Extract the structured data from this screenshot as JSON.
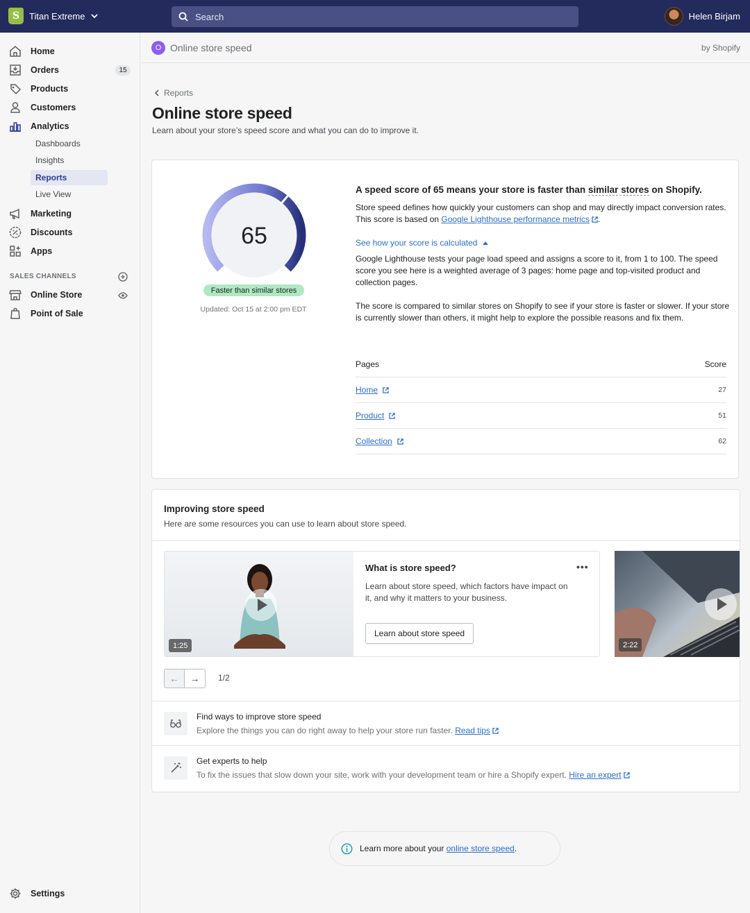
{
  "topbar": {
    "store_name": "Titan Extreme",
    "search_placeholder": "Search",
    "user_name": "Helen Birjam",
    "logo_letter": "S"
  },
  "sidebar": {
    "items": [
      {
        "label": "Home"
      },
      {
        "label": "Orders",
        "badge": "15"
      },
      {
        "label": "Products"
      },
      {
        "label": "Customers"
      },
      {
        "label": "Analytics"
      }
    ],
    "analytics_sub": [
      {
        "label": "Dashboards"
      },
      {
        "label": "Insights"
      },
      {
        "label": "Reports",
        "active": true
      },
      {
        "label": "Live View"
      }
    ],
    "items2": [
      {
        "label": "Marketing"
      },
      {
        "label": "Discounts"
      },
      {
        "label": "Apps"
      }
    ],
    "sales_channels_label": "SALES CHANNELS",
    "channels": [
      {
        "label": "Online Store"
      },
      {
        "label": "Point of Sale"
      }
    ],
    "settings_label": "Settings"
  },
  "app_header": {
    "icon_letter": "O",
    "name": "Online store speed",
    "by": "by Shopify"
  },
  "page": {
    "breadcrumb": "Reports",
    "title": "Online store speed",
    "subtitle": "Learn about your store’s speed score and what you can do to improve it."
  },
  "score_card": {
    "score": "65",
    "score_value": 65,
    "score_max": 100,
    "status": "Faster than similar stores",
    "updated": "Updated: Oct 15 at 2:00 pm EDT",
    "headline_pre": "A speed score of 65 means your store is faster than ",
    "headline_link": "similar stores",
    "headline_post": " on Shopify.",
    "desc_pre": "Store speed defines how quickly your customers can shop and may directly impact conversion rates. This score is based on ",
    "desc_link": "Google Lighthouse performance metrics",
    "desc_post": ".",
    "toggle_label": "See how your score is calculated",
    "explain1": "Google Lighthouse tests your page load speed and assigns a score to it, from 1 to 100. The speed score you see here is a weighted average of 3 pages: home page and top-visited product and collection pages.",
    "explain2": "The score is compared to similar stores on Shopify to see if your store is faster or slower. If your store is currently slower than others, it might help to explore the possible reasons and fix them.",
    "table": {
      "col_pages": "Pages",
      "col_score": "Score",
      "rows": [
        {
          "page": "Home",
          "score": "27"
        },
        {
          "page": "Product",
          "score": "51"
        },
        {
          "page": "Collection",
          "score": "62"
        }
      ]
    },
    "colors": {
      "gauge_dark": "#25307a",
      "gauge_light": "#a7adee",
      "badge": "#aee9c1"
    }
  },
  "resources": {
    "title": "Improving store speed",
    "subtitle": "Here are some resources you can use to learn about store speed.",
    "video": {
      "duration": "1:25",
      "title": "What is store speed?",
      "desc": "Learn about store speed, which factors have impact on it, and why it matters to your business.",
      "button": "Learn about store speed",
      "menu": "•••"
    },
    "video2_duration": "2:22",
    "pager": {
      "prev": "←",
      "next": "→",
      "count": "1/2"
    },
    "items": [
      {
        "title": "Find ways to improve store speed",
        "desc": "Explore the things you can do right away to help your store run faster. ",
        "link": "Read tips"
      },
      {
        "title": "Get experts to help",
        "desc": "To fix the issues that slow down your site, work with your development team or hire a Shopify expert. ",
        "link": "Hire an expert"
      }
    ]
  },
  "footer": {
    "text": "Learn more about your ",
    "link": "online store speed",
    "post": "."
  }
}
